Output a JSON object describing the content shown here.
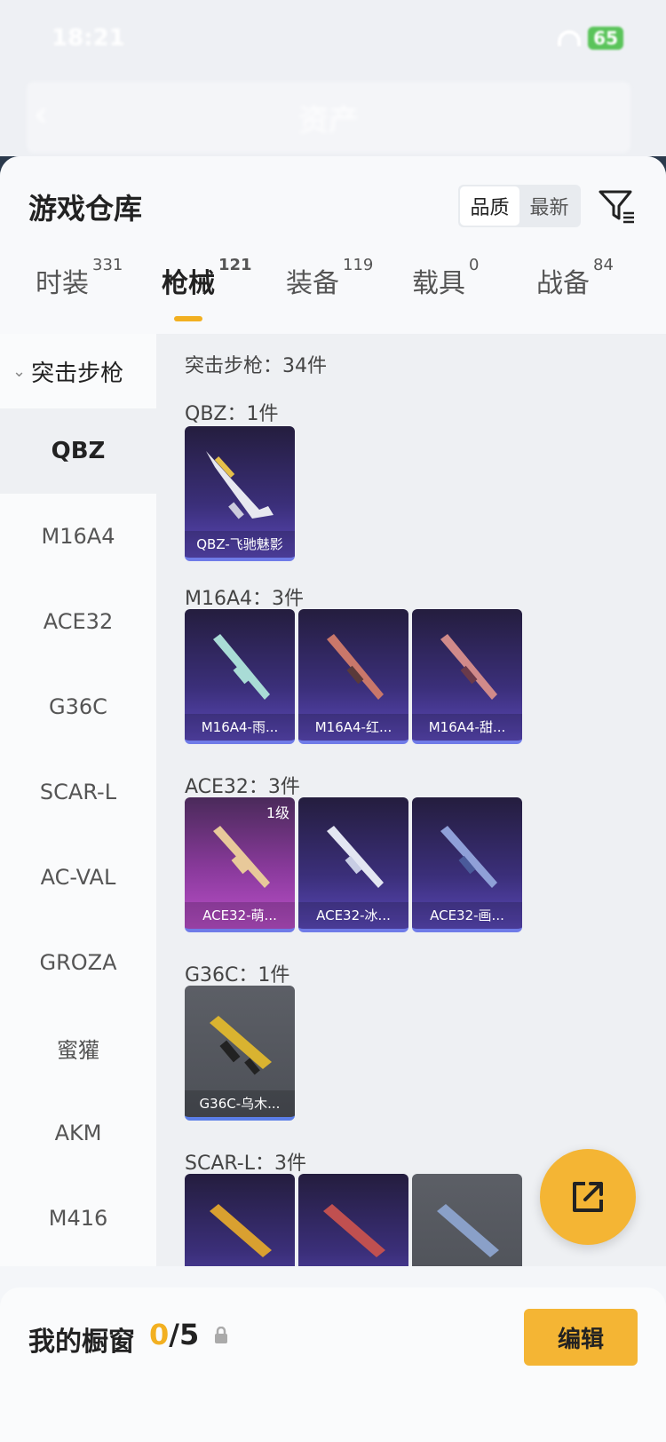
{
  "status_bar": {
    "time": "18:21",
    "battery": "65"
  },
  "nav": {
    "title": "资产"
  },
  "sheet": {
    "title": "游戏仓库",
    "sort": {
      "quality": "品质",
      "newest": "最新"
    }
  },
  "tabs": [
    {
      "label": "时装",
      "count": "331"
    },
    {
      "label": "枪械",
      "count": "121"
    },
    {
      "label": "装备",
      "count": "119"
    },
    {
      "label": "载具",
      "count": "0"
    },
    {
      "label": "战备",
      "count": "84"
    }
  ],
  "sidebar": {
    "group": "突击步枪",
    "items": [
      "QBZ",
      "M16A4",
      "ACE32",
      "G36C",
      "SCAR-L",
      "AC-VAL",
      "GROZA",
      "蜜獾",
      "AKM",
      "M416"
    ]
  },
  "content": {
    "summary": "突击步枪：34件",
    "sections": [
      {
        "title": "QBZ：1件",
        "cards": [
          {
            "name": "QBZ-飞驰魅影",
            "style": "purple"
          }
        ]
      },
      {
        "title": "M16A4：3件",
        "cards": [
          {
            "name": "M16A4-雨...",
            "style": "purple"
          },
          {
            "name": "M16A4-红...",
            "style": "purple"
          },
          {
            "name": "M16A4-甜...",
            "style": "purple"
          }
        ]
      },
      {
        "title": "ACE32：3件",
        "cards": [
          {
            "name": "ACE32-萌...",
            "style": "pink",
            "level": "1级"
          },
          {
            "name": "ACE32-冰...",
            "style": "purple"
          },
          {
            "name": "ACE32-画...",
            "style": "purple"
          }
        ]
      },
      {
        "title": "G36C：1件",
        "cards": [
          {
            "name": "G36C-乌木...",
            "style": "gray"
          }
        ]
      },
      {
        "title": "SCAR-L：3件",
        "cards": [
          {
            "name": "",
            "style": "purple"
          },
          {
            "name": "",
            "style": "purple"
          },
          {
            "name": "",
            "style": "gray"
          }
        ]
      }
    ]
  },
  "showcase": {
    "title": "我的橱窗",
    "used": "0",
    "total": "/5",
    "edit": "编辑"
  },
  "colors": {
    "accent": "#f2b021",
    "card_purple": "#3b2f7a",
    "card_gray": "#5c5f66"
  }
}
